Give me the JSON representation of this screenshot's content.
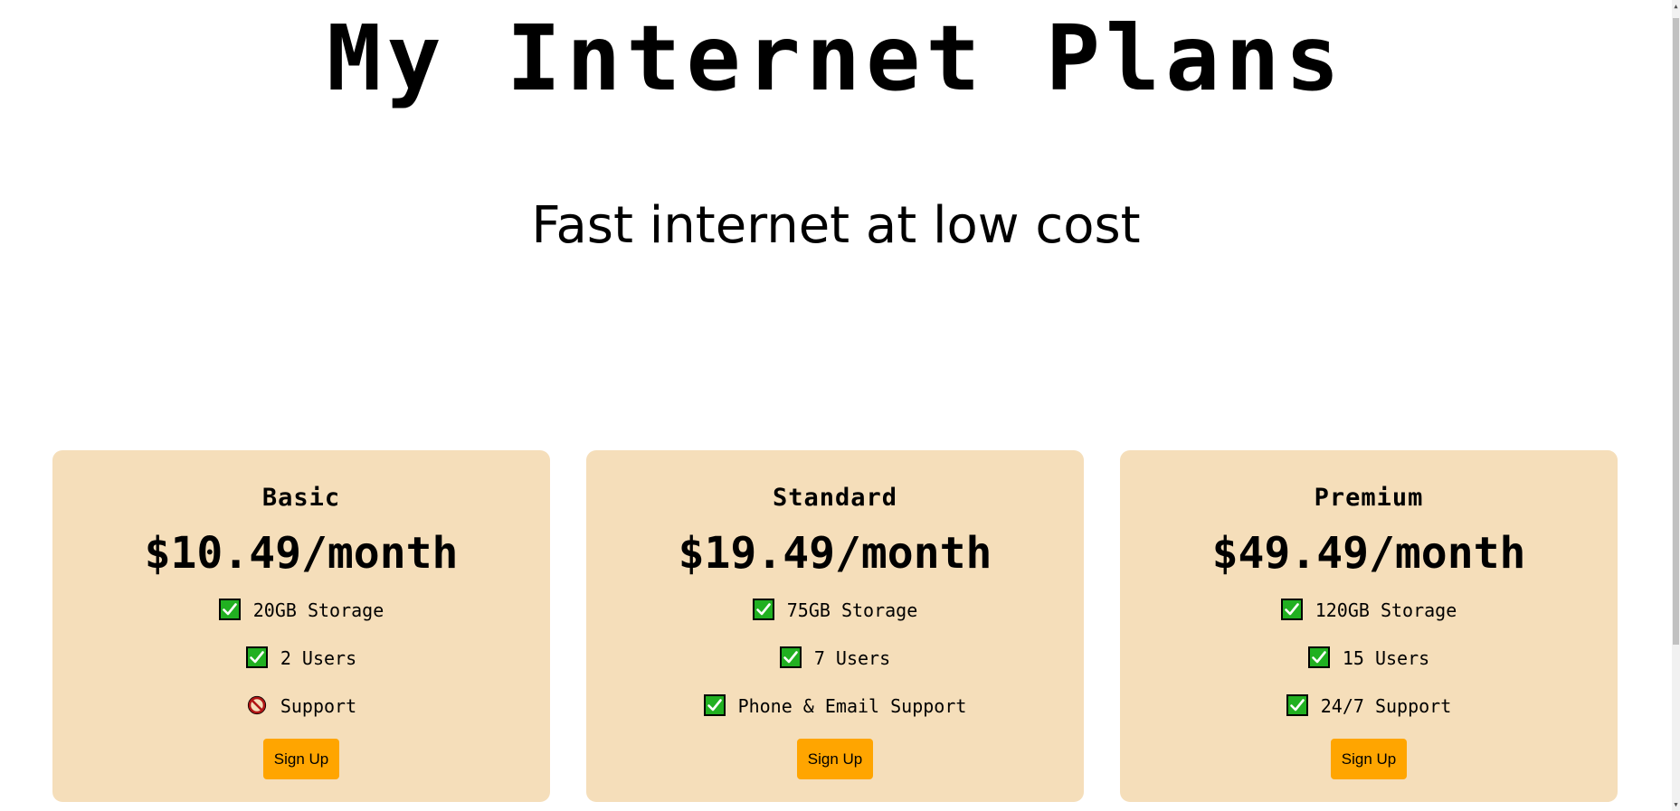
{
  "page": {
    "title": "My Internet Plans",
    "subtitle": "Fast internet at low cost"
  },
  "plans": [
    {
      "name": "Basic",
      "price": "$10.49/month",
      "features": [
        {
          "text": "20GB Storage",
          "icon": "check-icon"
        },
        {
          "text": "2 Users",
          "icon": "check-icon"
        },
        {
          "text": "Support",
          "icon": "prohibited-icon"
        }
      ],
      "button_label": "Sign Up"
    },
    {
      "name": "Standard",
      "price": "$19.49/month",
      "features": [
        {
          "text": "75GB Storage",
          "icon": "check-icon"
        },
        {
          "text": "7 Users",
          "icon": "check-icon"
        },
        {
          "text": "Phone & Email Support",
          "icon": "check-icon"
        }
      ],
      "button_label": "Sign Up"
    },
    {
      "name": "Premium",
      "price": "$49.49/month",
      "features": [
        {
          "text": "120GB Storage",
          "icon": "check-icon"
        },
        {
          "text": "15 Users",
          "icon": "check-icon"
        },
        {
          "text": "24/7 Support",
          "icon": "check-icon"
        }
      ],
      "button_label": "Sign Up"
    }
  ],
  "colors": {
    "card_background": "#f5deba",
    "button_background": "#ffa500",
    "check_green": "#21b021",
    "prohibited_red": "#b01515"
  }
}
